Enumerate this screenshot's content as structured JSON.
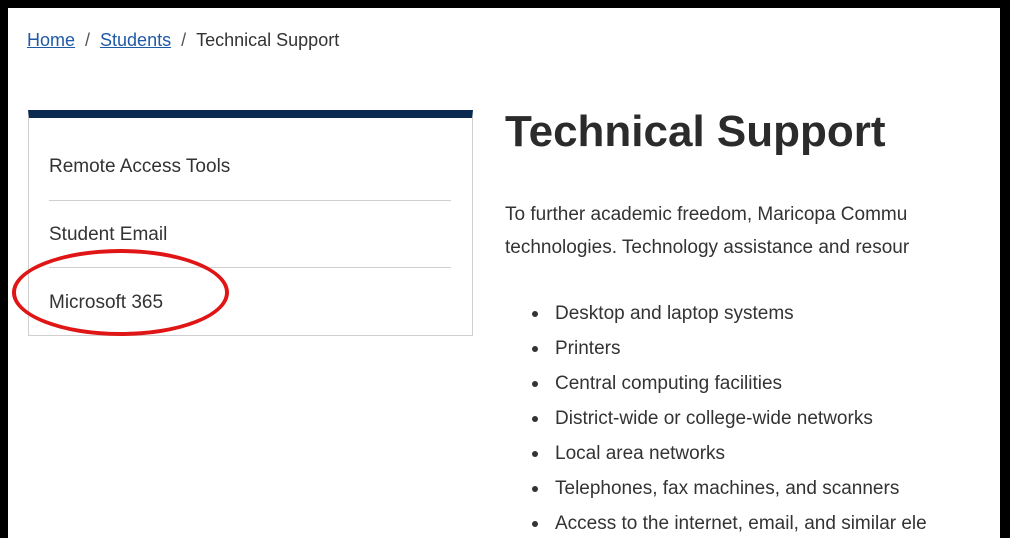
{
  "breadcrumb": {
    "items": [
      {
        "label": "Home",
        "link": true
      },
      {
        "label": "Students",
        "link": true
      },
      {
        "label": "Technical Support",
        "link": false
      }
    ],
    "separator": "/"
  },
  "sidebar": {
    "items": [
      {
        "label": "Remote Access Tools"
      },
      {
        "label": "Student Email"
      },
      {
        "label": "Microsoft 365",
        "highlighted": true
      }
    ],
    "accent_color": "#0a2a4f"
  },
  "main": {
    "title": "Technical Support",
    "intro_lines": [
      "To further academic freedom, Maricopa Commu",
      "technologies. Technology assistance and resour"
    ],
    "bullets": [
      "Desktop and laptop systems",
      "Printers",
      "Central computing facilities",
      "District-wide or college-wide networks",
      "Local area networks",
      "Telephones, fax machines, and scanners",
      "Access to the internet, email, and similar ele"
    ]
  },
  "annotation": {
    "color": "#e01515",
    "target": "Microsoft 365"
  },
  "colors": {
    "link": "#1f5aa6",
    "text": "#333333"
  }
}
